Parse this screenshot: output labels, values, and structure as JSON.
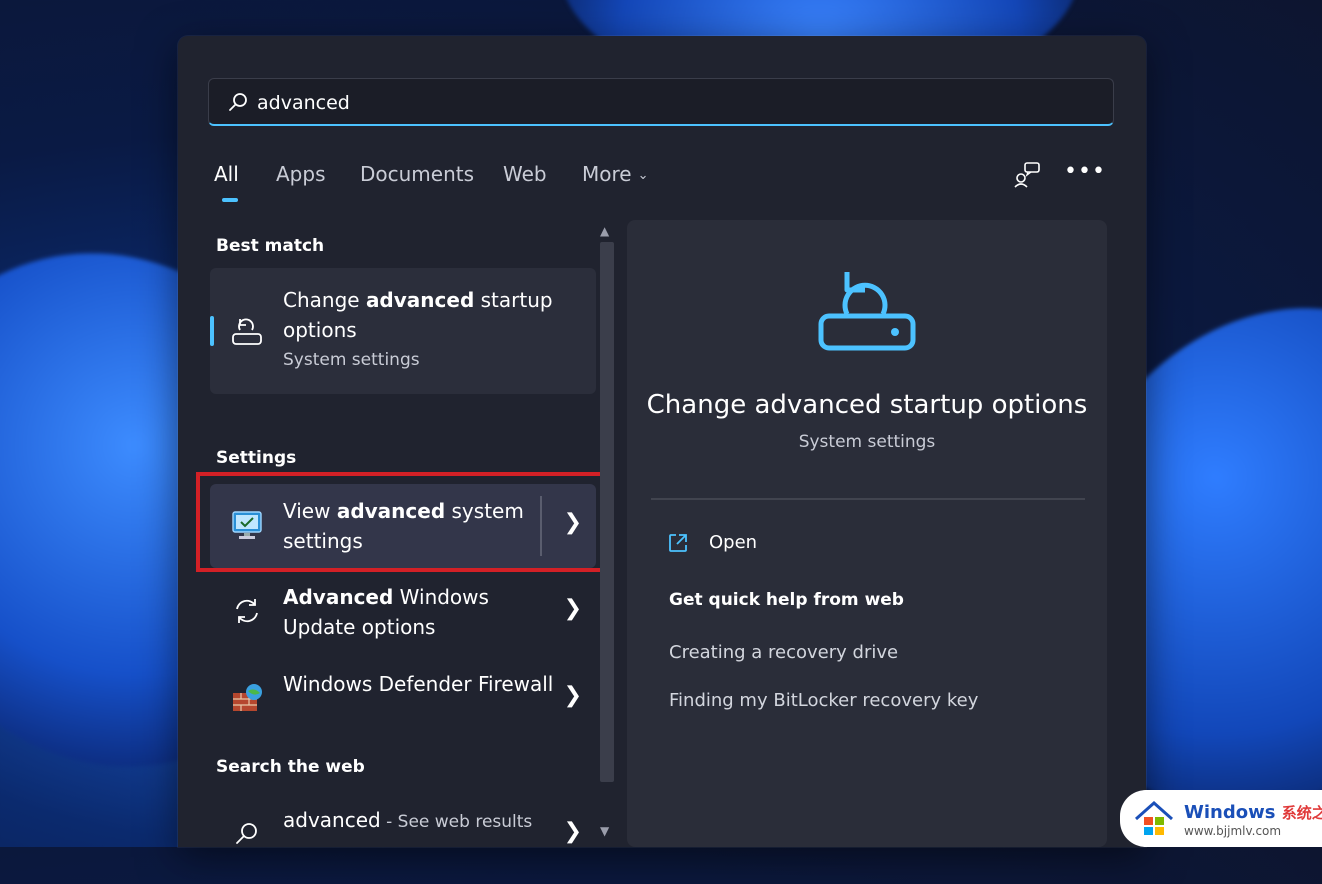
{
  "search": {
    "query": "advanced"
  },
  "tabs": [
    {
      "label": "All",
      "active": true
    },
    {
      "label": "Apps"
    },
    {
      "label": "Documents"
    },
    {
      "label": "Web"
    },
    {
      "label": "More"
    }
  ],
  "toolbar": {
    "more_options": "•••"
  },
  "sections": {
    "best_match": "Best match",
    "settings": "Settings",
    "search_web": "Search the web"
  },
  "results": {
    "best": {
      "title_pre": "Change ",
      "title_bold": "advanced",
      "title_post": " startup options",
      "subtitle": "System settings",
      "icon": "recovery-drive-icon"
    },
    "view_advanced": {
      "title_pre": "View ",
      "title_bold": "advanced",
      "title_post": " system settings",
      "icon": "system-properties-icon"
    },
    "windows_update": {
      "title_bold": "Advanced",
      "title_post": " Windows Update options",
      "icon": "sync-icon"
    },
    "defender": {
      "title": "Windows Defender Firewall",
      "icon": "firewall-icon"
    },
    "web": {
      "title_bold": "advanced",
      "title_post": " - See web results",
      "icon": "search-icon"
    }
  },
  "preview": {
    "title": "Change advanced startup options",
    "subtitle": "System settings",
    "open_label": "Open",
    "help_heading": "Get quick help from web",
    "links": [
      "Creating a recovery drive",
      "Finding my BitLocker recovery key"
    ]
  },
  "watermark": {
    "brand": "Windows",
    "brand_cn": "系统之家",
    "url": "www.bjjmlv.com"
  },
  "colors": {
    "accent": "#4cc2ff",
    "highlight_box": "#d32026",
    "panel_bg": "#20232f"
  }
}
